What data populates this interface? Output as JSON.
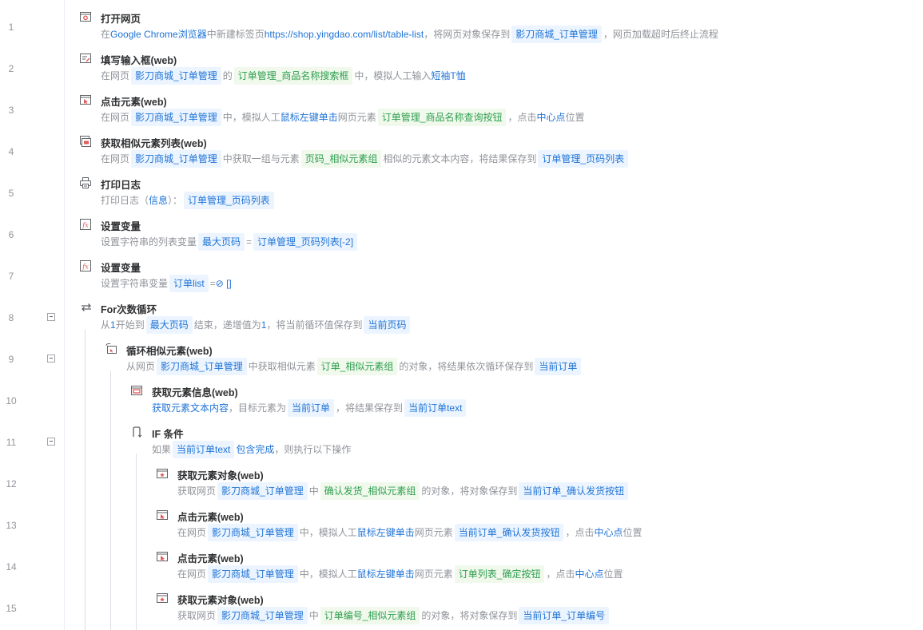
{
  "rows": [
    {
      "n": "1",
      "title": "打开网页",
      "icon": "browser-open-icon",
      "indent": 0,
      "desc": [
        [
          "t",
          "在 "
        ],
        [
          "b",
          "Google Chrome浏览器"
        ],
        [
          "t",
          " 中新建标签页 "
        ],
        [
          "b",
          "https://shop.yingdao.com/list/table-list"
        ],
        [
          "t",
          " ，将网页对象保存到 "
        ],
        [
          "v",
          "影刀商城_订单管理"
        ],
        [
          "t",
          " ，网页加载超时后终止流程"
        ]
      ]
    },
    {
      "n": "2",
      "title": "填写输入框(web)",
      "icon": "input-fill-icon",
      "indent": 0,
      "desc": [
        [
          "t",
          "在网页 "
        ],
        [
          "v",
          "影刀商城_订单管理"
        ],
        [
          "t",
          " 的 "
        ],
        [
          "e",
          "订单管理_商品名称搜索框"
        ],
        [
          "t",
          " 中，模拟人工输入 "
        ],
        [
          "b",
          "短袖T恤"
        ]
      ]
    },
    {
      "n": "3",
      "title": "点击元素(web)",
      "icon": "click-element-icon",
      "indent": 0,
      "desc": [
        [
          "t",
          "在网页 "
        ],
        [
          "v",
          "影刀商城_订单管理"
        ],
        [
          "t",
          " 中，模拟人工 "
        ],
        [
          "b",
          "鼠标左键"
        ],
        [
          "t",
          " "
        ],
        [
          "b",
          "单击"
        ],
        [
          "t",
          " 网页元素 "
        ],
        [
          "e",
          "订单管理_商品名称查询按钮"
        ],
        [
          "t",
          " ，点击 "
        ],
        [
          "b",
          "中心点"
        ],
        [
          "t",
          " 位置"
        ]
      ]
    },
    {
      "n": "4",
      "title": "获取相似元素列表(web)",
      "icon": "similar-elements-icon",
      "indent": 0,
      "desc": [
        [
          "t",
          "在网页 "
        ],
        [
          "v",
          "影刀商城_订单管理"
        ],
        [
          "t",
          " 中获取一组与元素 "
        ],
        [
          "e",
          "页码_相似元素组"
        ],
        [
          "t",
          " 相似的元素文本内容，将结果保存到 "
        ],
        [
          "v",
          "订单管理_页码列表"
        ]
      ]
    },
    {
      "n": "5",
      "title": "打印日志",
      "icon": "print-log-icon",
      "indent": 0,
      "desc": [
        [
          "t",
          "打印日志（ "
        ],
        [
          "b",
          "信息"
        ],
        [
          "t",
          " ）： "
        ],
        [
          "v",
          "订单管理_页码列表"
        ]
      ]
    },
    {
      "n": "6",
      "title": "设置变量",
      "icon": "set-variable-icon",
      "indent": 0,
      "desc": [
        [
          "t",
          "设置字符串的列表变量 "
        ],
        [
          "v",
          "最大页码"
        ],
        [
          "t",
          " = "
        ],
        [
          "v",
          "订单管理_页码列表[-2]"
        ]
      ]
    },
    {
      "n": "7",
      "title": "设置变量",
      "icon": "set-variable-icon",
      "indent": 0,
      "desc": [
        [
          "t",
          "设置字符串变量 "
        ],
        [
          "v",
          "订单list"
        ],
        [
          "t",
          " = "
        ],
        [
          "b",
          "⊘ []"
        ]
      ]
    },
    {
      "n": "8",
      "title": "For次数循环",
      "icon": "loop-icon",
      "indent": 0,
      "collapse": true,
      "desc": [
        [
          "t",
          "从 "
        ],
        [
          "b",
          "1"
        ],
        [
          "t",
          " 开始到 "
        ],
        [
          "v",
          "最大页码"
        ],
        [
          "t",
          " 结束，递增值为 "
        ],
        [
          "b",
          "1"
        ],
        [
          "t",
          " ，将当前循环值保存到 "
        ],
        [
          "v",
          "当前页码"
        ]
      ]
    },
    {
      "n": "9",
      "title": "循环相似元素(web)",
      "icon": "loop-similar-icon",
      "indent": 1,
      "collapse": true,
      "desc": [
        [
          "t",
          "从网页 "
        ],
        [
          "v",
          "影刀商城_订单管理"
        ],
        [
          "t",
          " 中获取相似元素 "
        ],
        [
          "e",
          "订单_相似元素组"
        ],
        [
          "t",
          " 的对象，将结果依次循环保存到 "
        ],
        [
          "v",
          "当前订单"
        ]
      ]
    },
    {
      "n": "10",
      "title": "获取元素信息(web)",
      "icon": "element-info-icon",
      "indent": 2,
      "desc": [
        [
          "b",
          "获取元素文本内容"
        ],
        [
          "t",
          " ，目标元素为 "
        ],
        [
          "v",
          "当前订单"
        ],
        [
          "t",
          " ，将结果保存到 "
        ],
        [
          "v",
          "当前订单text"
        ]
      ]
    },
    {
      "n": "11",
      "title": "IF 条件",
      "icon": "if-condition-icon",
      "indent": 2,
      "collapse": true,
      "desc": [
        [
          "t",
          "如果 "
        ],
        [
          "v",
          "当前订单text"
        ],
        [
          "t",
          " "
        ],
        [
          "b",
          "包含"
        ],
        [
          "t",
          " "
        ],
        [
          "b",
          "完成"
        ],
        [
          "t",
          " ，则执行以下操作"
        ]
      ]
    },
    {
      "n": "12",
      "title": "获取元素对象(web)",
      "icon": "element-object-icon",
      "indent": 3,
      "desc": [
        [
          "t",
          "获取网页 "
        ],
        [
          "v",
          "影刀商城_订单管理"
        ],
        [
          "t",
          " 中 "
        ],
        [
          "e",
          "确认发货_相似元素组"
        ],
        [
          "t",
          " 的对象，将对象保存到 "
        ],
        [
          "v",
          "当前订单_确认发货按钮"
        ]
      ]
    },
    {
      "n": "13",
      "title": "点击元素(web)",
      "icon": "click-element-icon",
      "indent": 3,
      "desc": [
        [
          "t",
          "在网页 "
        ],
        [
          "v",
          "影刀商城_订单管理"
        ],
        [
          "t",
          " 中，模拟人工 "
        ],
        [
          "b",
          "鼠标左键"
        ],
        [
          "t",
          " "
        ],
        [
          "b",
          "单击"
        ],
        [
          "t",
          " 网页元素 "
        ],
        [
          "v",
          "当前订单_确认发货按钮"
        ],
        [
          "t",
          " ，点击 "
        ],
        [
          "b",
          "中心点"
        ],
        [
          "t",
          " 位置"
        ]
      ]
    },
    {
      "n": "14",
      "title": "点击元素(web)",
      "icon": "click-element-icon",
      "indent": 3,
      "desc": [
        [
          "t",
          "在网页 "
        ],
        [
          "v",
          "影刀商城_订单管理"
        ],
        [
          "t",
          " 中，模拟人工 "
        ],
        [
          "b",
          "鼠标左键"
        ],
        [
          "t",
          " "
        ],
        [
          "b",
          "单击"
        ],
        [
          "t",
          " 网页元素 "
        ],
        [
          "e",
          "订单列表_确定按钮"
        ],
        [
          "t",
          " ，点击 "
        ],
        [
          "b",
          "中心点"
        ],
        [
          "t",
          " 位置"
        ]
      ]
    },
    {
      "n": "15",
      "title": "获取元素对象(web)",
      "icon": "element-object-icon",
      "indent": 3,
      "desc": [
        [
          "t",
          "获取网页 "
        ],
        [
          "v",
          "影刀商城_订单管理"
        ],
        [
          "t",
          " 中 "
        ],
        [
          "e",
          "订单编号_相似元素组"
        ],
        [
          "t",
          " 的对象，将对象保存到 "
        ],
        [
          "v",
          "当前订单_订单编号"
        ]
      ]
    }
  ],
  "colors": {
    "accent": "#1f73d6",
    "element": "#2e9e50",
    "icon": "#e05a5a"
  }
}
